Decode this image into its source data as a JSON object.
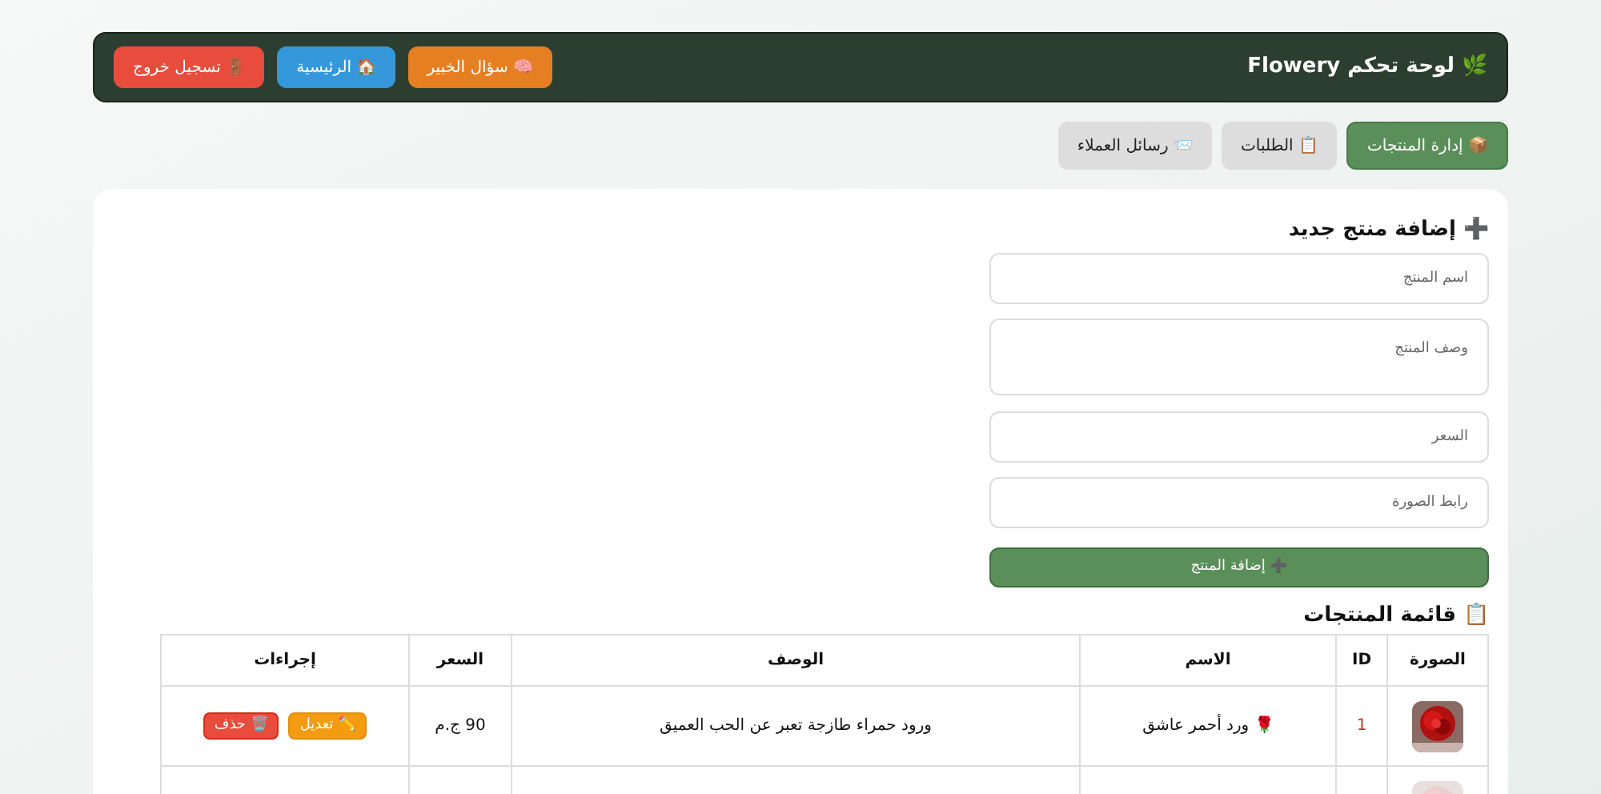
{
  "header": {
    "title": "🌿 لوحة تحكم Flowery",
    "buttons": [
      {
        "label": "🧠 سؤال الخبير",
        "color": "#e67e22"
      },
      {
        "label": "🏠 الرئيسية",
        "color": "#3498db"
      },
      {
        "label": "🚪 تسجيل خروج",
        "color": "#e74c3c"
      }
    ]
  },
  "tabs": [
    {
      "label": "📦 إدارة المنتجات",
      "selected": true
    },
    {
      "label": "📋 الطلبات",
      "selected": false
    },
    {
      "label": "📨 رسائل العملاء",
      "selected": false
    }
  ],
  "form": {
    "title": "➕ إضافة منتج جديد",
    "fields": [
      {
        "kind": "input",
        "placeholder": "اسم المنتج"
      },
      {
        "kind": "textarea",
        "placeholder": "وصف المنتج"
      },
      {
        "kind": "input",
        "placeholder": "السعر"
      },
      {
        "kind": "input",
        "placeholder": "رابط الصورة"
      }
    ],
    "submit": "➕ إضافة المنتج"
  },
  "table": {
    "title": "📋 قائمة المنتجات",
    "columns": [
      "الصورة",
      "ID",
      "الاسم",
      "الوصف",
      "السعر",
      "إجراءات"
    ],
    "rows": [
      {
        "image": {
          "kind": "picture"
        },
        "id": "1",
        "name": "🌹 ورد أحمر عاشق",
        "description": "ورود حمراء طازجة تعبر عن الحب العميق",
        "price": "90 ج.م",
        "actions": [
          {
            "kind": "edit",
            "label": "✏️ تعديل"
          },
          {
            "kind": "delete",
            "label": "🗑️ حذف"
          }
        ]
      },
      {
        "image": {
          "kind": "picture"
        }
      }
    ]
  }
}
